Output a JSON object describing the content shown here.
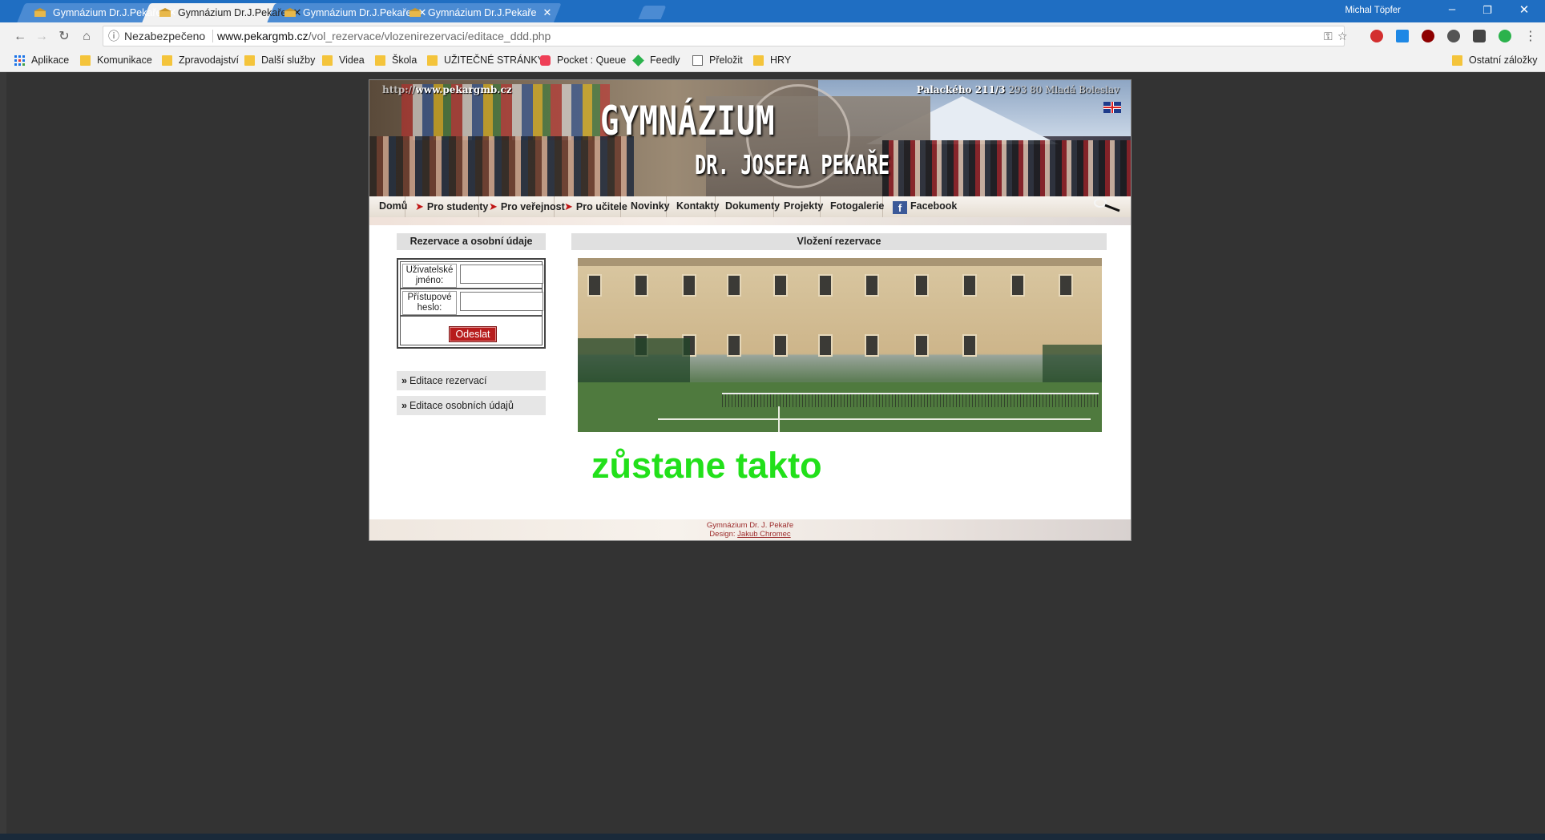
{
  "browser": {
    "tabs": [
      {
        "title": "Gymnázium Dr.J.Pekaře",
        "active": false
      },
      {
        "title": "Gymnázium Dr.J.Pekaře",
        "active": true
      },
      {
        "title": "Gymnázium Dr.J.Pekaře",
        "active": false
      },
      {
        "title": "Gymnázium Dr.J.Pekaře",
        "active": false
      }
    ],
    "user": "Michal Töpfer",
    "security_label": "Nezabezpečeno",
    "url_host": "www.pekargmb.cz",
    "url_path": "/vol_rezervace/vlozenirezervaci/editace_ddd.php",
    "bookmarks": [
      {
        "label": "Aplikace",
        "icon": "apps-grid-icon"
      },
      {
        "label": "Komunikace",
        "icon": "folder-icon"
      },
      {
        "label": "Zpravodajství",
        "icon": "folder-icon"
      },
      {
        "label": "Další služby",
        "icon": "folder-icon"
      },
      {
        "label": "Videa",
        "icon": "folder-icon"
      },
      {
        "label": "Škola",
        "icon": "folder-icon"
      },
      {
        "label": "UŽITEČNÉ STRÁNKY",
        "icon": "folder-icon"
      },
      {
        "label": "Pocket : Queue",
        "icon": "pocket-icon"
      },
      {
        "label": "Feedly",
        "icon": "feedly-icon"
      },
      {
        "label": "Přeložit",
        "icon": "page-icon"
      },
      {
        "label": "HRY",
        "icon": "folder-icon"
      }
    ],
    "other_bookmarks": "Ostatní záložky"
  },
  "site": {
    "header": {
      "url_text": "http://www.pekargmb.cz",
      "url_prefix": "http://",
      "url_domain": "www.pekargmb.cz",
      "address_street": "Palackého 211/3",
      "address_city": " 293 80 Mladá Boleslav",
      "logo_line1": "GYMNÁZIUM",
      "logo_line2": "DR. JOSEFA PEKAŘE"
    },
    "menu": [
      {
        "label": "Domů",
        "arrow": false
      },
      {
        "label": "Pro studenty",
        "arrow": true
      },
      {
        "label": "Pro veřejnost",
        "arrow": true
      },
      {
        "label": "Pro učitele",
        "arrow": true
      },
      {
        "label": "Novinky",
        "arrow": false
      },
      {
        "label": "Kontakty",
        "arrow": false
      },
      {
        "label": "Dokumenty",
        "arrow": false
      },
      {
        "label": "Projekty",
        "arrow": false
      },
      {
        "label": "Fotogalerie",
        "arrow": false
      },
      {
        "label": "Facebook",
        "arrow": false
      }
    ],
    "sidebar": {
      "title": "Rezervace a osobní údaje",
      "username_label": "Uživatelské jméno:",
      "password_label": "Přístupové heslo:",
      "username_value": "",
      "password_value": "",
      "submit_label": "Odeslat",
      "links": [
        "Editace rezervací",
        "Editace osobních údajů"
      ]
    },
    "main": {
      "title": "Vložení rezervace",
      "message": "zůstane takto"
    },
    "footer": {
      "line1": "Gymnázium Dr. J. Pekaře",
      "design_label": "Design: ",
      "designer": "Jakub Chromec"
    }
  },
  "colors": {
    "titlebar": "#1f6ec2",
    "page_bg": "#333333",
    "submit_bg": "#b71c1c",
    "message_green": "#22e01a",
    "footer_text": "#9c2b2b"
  }
}
